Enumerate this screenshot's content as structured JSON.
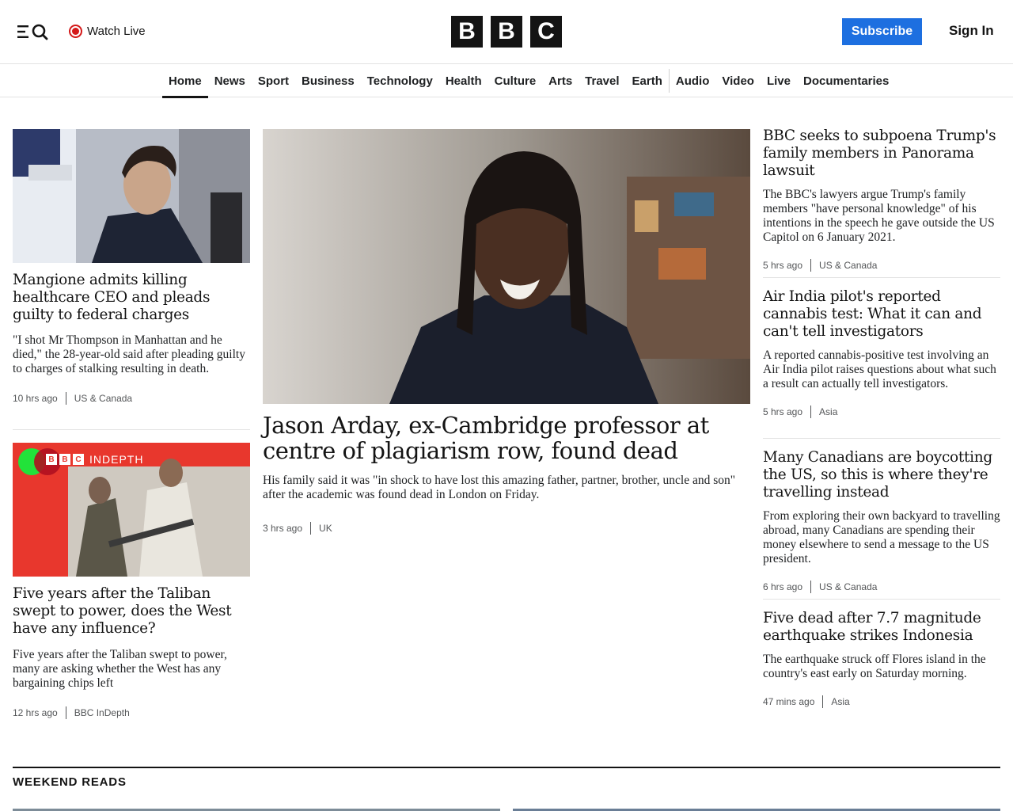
{
  "header": {
    "watch_live": "Watch Live",
    "logo_letters": [
      "B",
      "B",
      "C"
    ],
    "subscribe": "Subscribe",
    "sign_in": "Sign In"
  },
  "nav": {
    "items": [
      "Home",
      "News",
      "Sport",
      "Business",
      "Technology",
      "Health",
      "Culture",
      "Arts",
      "Travel",
      "Earth",
      "Audio",
      "Video",
      "Live",
      "Documentaries"
    ],
    "active": "Home"
  },
  "left": [
    {
      "headline": "Mangione admits killing healthcare CEO and pleads guilty to federal charges",
      "summary": "\"I shot Mr Thompson in Manhattan and he died,\" the 28-year-old said after pleading guilty to charges of stalking resulting in death.",
      "time": "10 hrs ago",
      "section": "US & Canada"
    },
    {
      "headline": "Five years after the Taliban swept to power, does the West have any influence?",
      "summary": "Five years after the Taliban swept to power, many are asking whether the West has any bargaining chips left",
      "time": "12 hrs ago",
      "section": "BBC InDepth",
      "badge": "INDEPTH"
    }
  ],
  "main": {
    "headline": "Jason Arday, ex-Cambridge professor at centre of plagiarism row, found dead",
    "summary": "His family said it was \"in shock to have lost this amazing father, partner, brother, uncle and son\" after the academic was found dead in London on Friday.",
    "time": "3 hrs ago",
    "section": "UK"
  },
  "right": [
    {
      "headline": "BBC seeks to subpoena Trump's family members in Panorama lawsuit",
      "summary": "The BBC's lawyers argue Trump's family members \"have personal knowledge\" of his intentions in the speech he gave outside the US Capitol on 6 January 2021.",
      "time": "5 hrs ago",
      "section": "US & Canada"
    },
    {
      "headline": "Air India pilot's reported cannabis test: What it can and can't tell investigators",
      "summary": "A reported cannabis-positive test involving an Air India pilot raises questions about what such a result can actually tell investigators.",
      "time": "5 hrs ago",
      "section": "Asia"
    },
    {
      "headline": "Many Canadians are boycotting the US, so this is where they're travelling instead",
      "summary": "From exploring their own backyard to travelling abroad, many Canadians are spending their money elsewhere to send a message to the US president.",
      "time": "6 hrs ago",
      "section": "US & Canada"
    },
    {
      "headline": "Five dead after 7.7 magnitude earthquake strikes Indonesia",
      "summary": "The earthquake struck off Flores island in the country's east early on Saturday morning.",
      "time": "47 mins ago",
      "section": "Asia"
    }
  ],
  "weekend": {
    "title": "WEEKEND READS"
  },
  "colors": {
    "subscribe": "#1d6fe0",
    "live": "#d41a1a",
    "indepth_red": "#e8372d"
  }
}
